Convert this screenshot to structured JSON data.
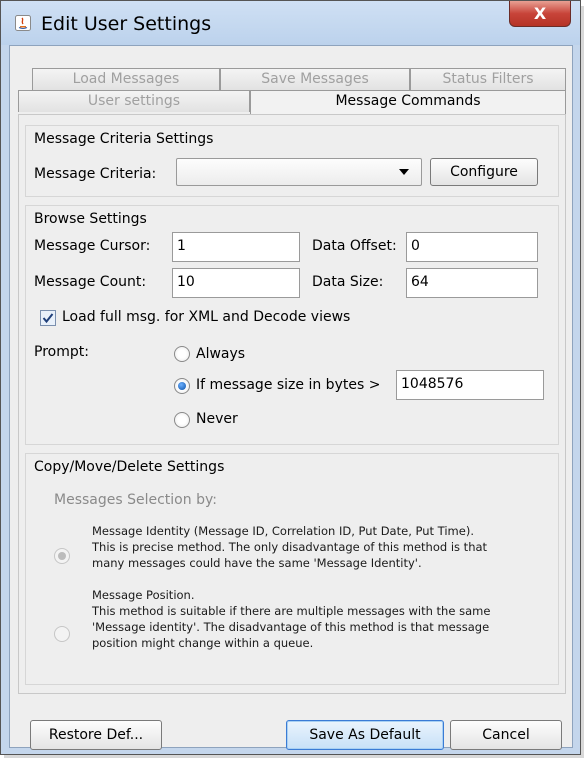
{
  "window": {
    "title": "Edit User Settings",
    "close_glyph": "X"
  },
  "tabs": {
    "row1": [
      "Load Messages",
      "Save Messages",
      "Status Filters"
    ],
    "row2": [
      "User settings",
      "Message Commands"
    ],
    "active": "Message Commands"
  },
  "criteria": {
    "title": "Message Criteria Settings",
    "label": "Message Criteria:",
    "selected": "",
    "configure_label": "Configure"
  },
  "browse": {
    "title": "Browse Settings",
    "cursor_label": "Message Cursor:",
    "cursor_value": "1",
    "offset_label": "Data Offset:",
    "offset_value": "0",
    "count_label": "Message Count:",
    "count_value": "10",
    "size_label": "Data Size:",
    "size_value": "64",
    "load_full_label": "Load full msg. for XML and Decode views",
    "load_full_checked": true,
    "prompt_label": "Prompt:",
    "options": [
      "Always",
      "If message size in bytes >",
      "Never"
    ],
    "selected_option": "If message size in bytes >",
    "threshold_value": "1048576"
  },
  "copy_move": {
    "title": "Copy/Move/Delete Settings",
    "selection_label": "Messages Selection by:",
    "identity_text": [
      "Message Identity (Message ID, Correlation ID, Put Date, Put Time).",
      "This is precise method. The only disadvantage of this method is that",
      "many messages could have the same 'Message Identity'."
    ],
    "position_text": [
      "Message Position.",
      "This method is suitable if there are multiple messages with the same",
      "'Message identity'. The disadvantage of this method is that message",
      "position might change within a queue."
    ],
    "selected": "identity"
  },
  "footer": {
    "restore_label": "Restore Def...",
    "save_default_label": "Save As Default",
    "cancel_label": "Cancel"
  }
}
